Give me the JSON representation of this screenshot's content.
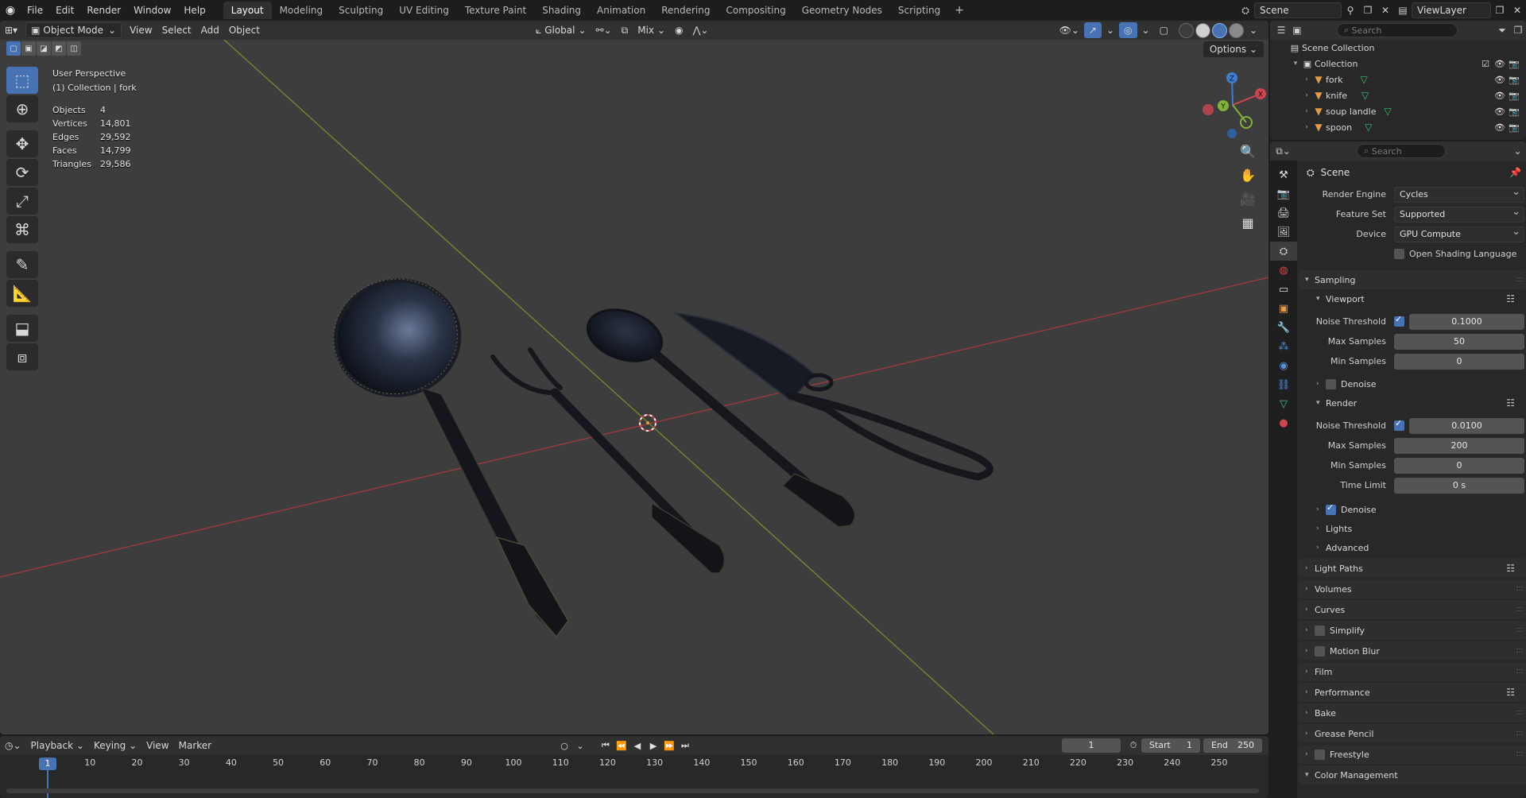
{
  "menubar": {
    "items": [
      "File",
      "Edit",
      "Render",
      "Window",
      "Help"
    ],
    "workspaces": [
      "Layout",
      "Modeling",
      "Sculpting",
      "UV Editing",
      "Texture Paint",
      "Shading",
      "Animation",
      "Rendering",
      "Compositing",
      "Geometry Nodes",
      "Scripting"
    ],
    "active_workspace": "Layout",
    "add_symbol": "+",
    "scene": "Scene",
    "view_layer": "ViewLayer"
  },
  "viewport": {
    "mode": "Object Mode",
    "menus": [
      "View",
      "Select",
      "Add",
      "Object"
    ],
    "orientation": "Global",
    "blend": "Mix",
    "options_label": "Options",
    "perspective": "User Perspective",
    "collection_line": "(1) Collection | fork",
    "stats": [
      {
        "label": "Objects",
        "value": "4"
      },
      {
        "label": "Vertices",
        "value": "14,801"
      },
      {
        "label": "Edges",
        "value": "29,592"
      },
      {
        "label": "Faces",
        "value": "14,799"
      },
      {
        "label": "Triangles",
        "value": "29,586"
      }
    ],
    "gizmo": {
      "x": "X",
      "y": "Y",
      "z": "Z"
    },
    "colors": {
      "x_axis": "#d0464f",
      "y_axis": "#83b23a",
      "z_axis": "#3c7ed2",
      "background": "#3d3d3d"
    }
  },
  "outliner": {
    "search_placeholder": "Search",
    "scene_collection": "Scene Collection",
    "collection": "Collection",
    "objects": [
      "fork",
      "knife",
      "soup landle",
      "spoon"
    ]
  },
  "properties": {
    "search_placeholder": "Search",
    "context": "Scene",
    "render_engine_label": "Render Engine",
    "render_engine": "Cycles",
    "feature_set_label": "Feature Set",
    "feature_set": "Supported",
    "device_label": "Device",
    "device": "GPU Compute",
    "osl_label": "Open Shading Language",
    "sampling": "Sampling",
    "viewport_panel": "Viewport",
    "vp_noise_label": "Noise Threshold",
    "vp_noise": "0.1000",
    "vp_max_label": "Max Samples",
    "vp_max": "50",
    "vp_min_label": "Min Samples",
    "vp_min": "0",
    "vp_denoise": "Denoise",
    "render_panel": "Render",
    "r_noise_label": "Noise Threshold",
    "r_noise": "0.0100",
    "r_max_label": "Max Samples",
    "r_max": "200",
    "r_min_label": "Min Samples",
    "r_min": "0",
    "r_time_label": "Time Limit",
    "r_time": "0 s",
    "r_denoise": "Denoise",
    "lights": "Lights",
    "advanced": "Advanced",
    "panels": [
      "Light Paths",
      "Volumes",
      "Curves",
      "Simplify",
      "Motion Blur",
      "Film",
      "Performance",
      "Bake",
      "Grease Pencil",
      "Freestyle",
      "Color Management"
    ]
  },
  "timeline": {
    "menus": [
      "Playback",
      "Keying",
      "View",
      "Marker"
    ],
    "current_frame": "1",
    "start_label": "Start",
    "start": "1",
    "end_label": "End",
    "end": "250",
    "ticks": [
      "1",
      "10",
      "20",
      "30",
      "40",
      "50",
      "60",
      "70",
      "80",
      "90",
      "100",
      "110",
      "120",
      "130",
      "140",
      "150",
      "160",
      "170",
      "180",
      "190",
      "200",
      "210",
      "220",
      "230",
      "240",
      "250"
    ]
  }
}
